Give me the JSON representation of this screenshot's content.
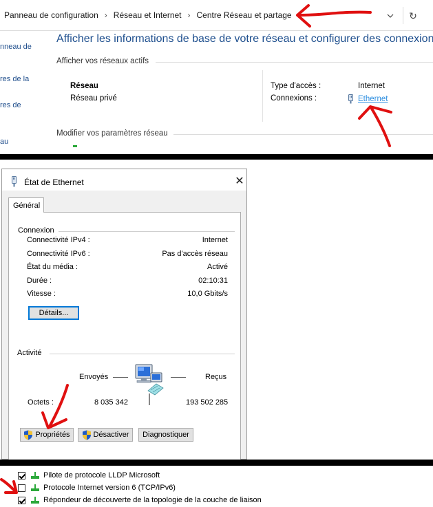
{
  "network_center": {
    "breadcrumb": [
      "Panneau de configuration",
      "Réseau et Internet",
      "Centre Réseau et partage"
    ],
    "sidebar_links": [
      "nneau de",
      "res de la",
      "res de",
      "au"
    ],
    "title": "Afficher les informations de base de votre réseau et configurer des connexions",
    "active_networks_heading": "Afficher vos réseaux actifs",
    "network_name": "Réseau",
    "network_category": "Réseau privé",
    "access_type_label": "Type d'accès :",
    "access_type_value": "Internet",
    "connections_label": "Connexions :",
    "connection_link": "Ethernet",
    "modify_settings_heading": "Modifier vos paramètres réseau"
  },
  "status_dialog": {
    "title": "État de Ethernet",
    "tab": "Général",
    "connection_group": "Connexion",
    "rows": [
      {
        "label": "Connectivité IPv4 :",
        "value": "Internet"
      },
      {
        "label": "Connectivité IPv6 :",
        "value": "Pas d'accès réseau"
      },
      {
        "label": "État du média :",
        "value": "Activé"
      },
      {
        "label": "Durée :",
        "value": "02:10:31"
      },
      {
        "label": "Vitesse :",
        "value": "10,0 Gbits/s"
      }
    ],
    "details_button": "Détails...",
    "activity_group": "Activité",
    "sent_label": "Envoyés",
    "received_label": "Reçus",
    "bytes_label": "Octets :",
    "bytes_sent": "8 035 342",
    "bytes_received": "193 502 285",
    "properties_button": "Propriétés",
    "disable_button": "Désactiver",
    "diagnose_button": "Diagnostiquer"
  },
  "components": [
    {
      "label": "Pilote de protocole LLDP Microsoft",
      "checked": true
    },
    {
      "label": "Protocole Internet version 6 (TCP/IPv6)",
      "checked": false
    },
    {
      "label": "Répondeur de découverte de la topologie de la couche de liaison",
      "checked": true
    }
  ],
  "colors": {
    "link_blue": "#2f8fe0",
    "title_blue": "#1e4f8e",
    "arrow_red": "#e01010"
  },
  "icons": [
    "chevron-right-icon",
    "chevron-down-icon",
    "refresh-icon",
    "ethernet-plug-icon",
    "close-icon",
    "network-computers-icon",
    "uac-shield-icon",
    "network-adapter-icon"
  ]
}
